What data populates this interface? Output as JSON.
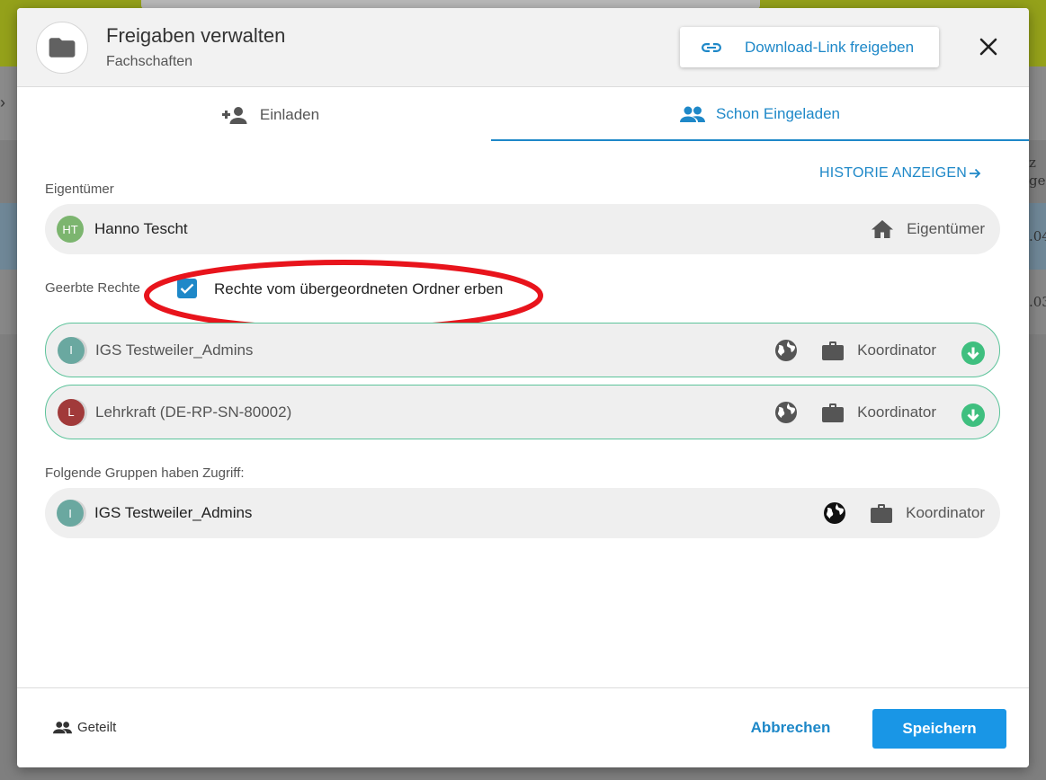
{
  "background": {
    "row_text_1": ".04",
    "row_text_2": ".03",
    "header_text_1": "z",
    "header_text_2": "ge"
  },
  "header": {
    "title": "Freigaben verwalten",
    "subtitle": "Fachschaften",
    "download_link_label": "Download-Link freigeben",
    "folder_icon": "folder-icon",
    "close_icon": "close-icon"
  },
  "tabs": [
    {
      "label": "Einladen",
      "icon": "person-add-icon",
      "active": false
    },
    {
      "label": "Schon Eingeladen",
      "icon": "group-icon",
      "active": true
    }
  ],
  "history_link": "HISTORIE ANZEIGEN",
  "owner": {
    "section_label": "Eigentümer",
    "initials": "HT",
    "name": "Hanno Tescht",
    "role": "Eigentümer",
    "avatar_color": "#7cb56f"
  },
  "inherited": {
    "section_label": "Geerbte Rechte",
    "checkbox_label": "Rechte vom übergeordneten Ordner erben",
    "checked": true,
    "entries": [
      {
        "initial": "I",
        "name": "IGS Testweiler_Admins",
        "role": "Koordinator",
        "avatar_color": "#6aa8a0"
      },
      {
        "initial": "L",
        "name": "Lehrkraft (DE-RP-SN-80002)",
        "role": "Koordinator",
        "avatar_color": "#a13a3a"
      }
    ]
  },
  "groups": {
    "section_label": "Folgende Gruppen haben Zugriff:",
    "entries": [
      {
        "initial": "I",
        "name": "IGS Testweiler_Admins",
        "role": "Koordinator",
        "avatar_color": "#6aa8a0"
      }
    ]
  },
  "footer": {
    "shared_label": "Geteilt",
    "cancel_label": "Abbrechen",
    "save_label": "Speichern"
  },
  "colors": {
    "accent": "#1e88c8",
    "primary_button": "#1996e6",
    "inherited_border": "#5cc39a",
    "inherited_arrow": "#3fbf7f",
    "highlight": "#e8141c"
  }
}
